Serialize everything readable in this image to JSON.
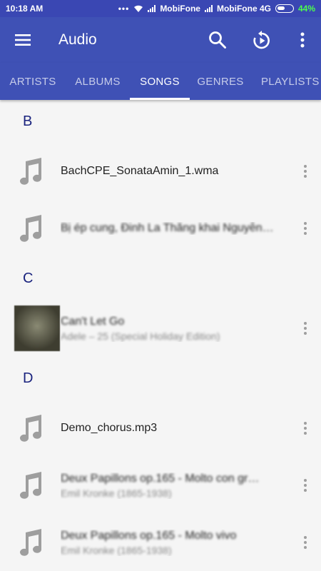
{
  "status_bar": {
    "time": "10:18 AM",
    "carrier1": "MobiFone",
    "carrier2": "MobiFone 4G",
    "battery": "44%"
  },
  "app_bar": {
    "title": "Audio",
    "icons": [
      "menu-icon",
      "search-icon",
      "replay-icon",
      "more-vert-icon"
    ]
  },
  "tabs": [
    {
      "label": "ARTISTS",
      "active": false
    },
    {
      "label": "ALBUMS",
      "active": false
    },
    {
      "label": "SONGS",
      "active": true
    },
    {
      "label": "GENRES",
      "active": false
    },
    {
      "label": "PLAYLISTS",
      "active": false
    }
  ],
  "sections": [
    {
      "letter": "B",
      "items": [
        {
          "title": "BachCPE_SonataAmin_1.wma",
          "subtitle": "",
          "art": false
        },
        {
          "title": "Bị ép cung, Đinh La Thăng khai Nguyễn…",
          "subtitle": "",
          "art": false
        }
      ]
    },
    {
      "letter": "C",
      "items": [
        {
          "title": "Can't Let Go",
          "subtitle": "Adele – 25 (Special Holiday Edition)",
          "art": true
        }
      ]
    },
    {
      "letter": "D",
      "items": [
        {
          "title": "Demo_chorus.mp3",
          "subtitle": "",
          "art": false
        },
        {
          "title": "Deux Papillons op.165 - Molto con gr…",
          "subtitle": "Emil Kronke (1865-1938)",
          "art": false
        },
        {
          "title": "Deux Papillons op.165 - Molto vivo",
          "subtitle": "Emil Kronke (1865-1938)",
          "art": false
        }
      ]
    }
  ],
  "colors": {
    "primary": "#3f51b5",
    "status_bar": "#3a47b3",
    "section_letter": "#1a237e"
  }
}
